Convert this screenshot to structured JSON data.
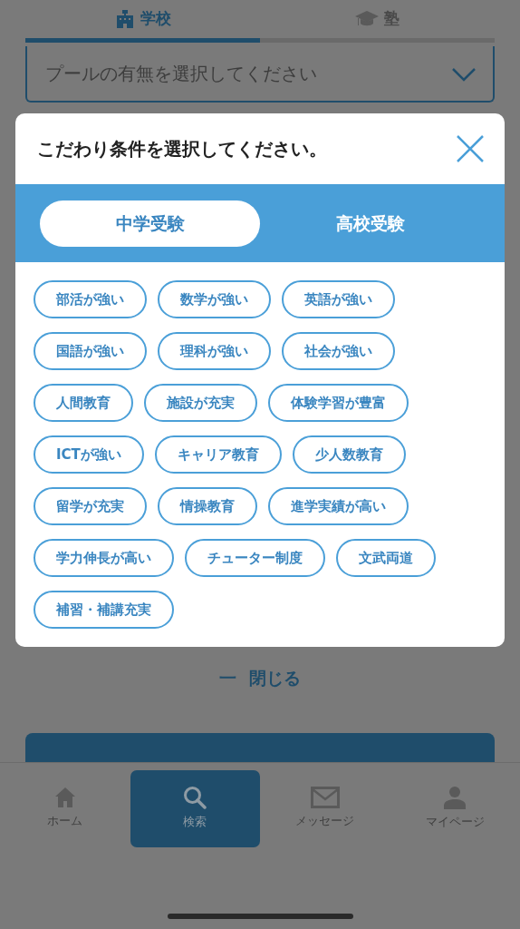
{
  "top_tabs": [
    {
      "label": "学校",
      "selected": true
    },
    {
      "label": "塾",
      "selected": false
    }
  ],
  "select": {
    "placeholder": "プールの有無を選択してください"
  },
  "modal": {
    "title": "こだわり条件を選択してください。",
    "segments": [
      {
        "label": "中学受験",
        "selected": true
      },
      {
        "label": "高校受験",
        "selected": false
      }
    ],
    "chips": [
      {
        "label": "部活が強い"
      },
      {
        "label": "数学が強い"
      },
      {
        "label": "英語が強い"
      },
      {
        "label": "国語が強い"
      },
      {
        "label": "理科が強い"
      },
      {
        "label": "社会が強い"
      },
      {
        "label": "人間教育"
      },
      {
        "label": "施設が充実"
      },
      {
        "label": "体験学習が豊富"
      },
      {
        "label": "ICTが強い"
      },
      {
        "label": "キャリア教育"
      },
      {
        "label": "少人数教育"
      },
      {
        "label": "留学が充実"
      },
      {
        "label": "情操教育"
      },
      {
        "label": "進学実績が高い"
      },
      {
        "label": "学力伸長が高い"
      },
      {
        "label": "チューター制度"
      },
      {
        "label": "文武両道"
      },
      {
        "label": "補習・補講充実"
      }
    ]
  },
  "close_link": {
    "icon": "一",
    "label": "閉じる"
  },
  "bottom_nav": [
    {
      "label": "ホーム",
      "selected": false
    },
    {
      "label": "検索",
      "selected": true
    },
    {
      "label": "メッセージ",
      "selected": false
    },
    {
      "label": "マイページ",
      "selected": false
    }
  ]
}
